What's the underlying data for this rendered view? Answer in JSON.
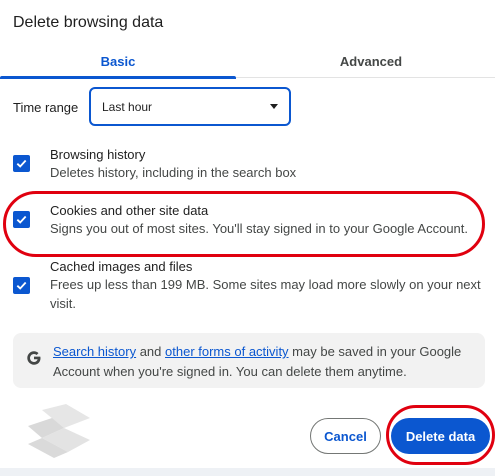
{
  "dialog": {
    "title": "Delete browsing data",
    "tabs": [
      {
        "label": "Basic",
        "selected": true
      },
      {
        "label": "Advanced",
        "selected": false
      }
    ],
    "time_range": {
      "label": "Time range",
      "selected": "Last hour"
    },
    "options": [
      {
        "title": "Browsing history",
        "description": "Deletes history, including in the search box",
        "checked": true
      },
      {
        "title": "Cookies and other site data",
        "description": "Signs you out of most sites. You'll stay signed in to your Google Account.",
        "checked": true
      },
      {
        "title": "Cached images and files",
        "description": "Frees up less than 199 MB. Some sites may load more slowly on your next visit.",
        "checked": true
      }
    ],
    "notice": {
      "link1": "Search history",
      "text1": " and ",
      "link2": "other forms of activity",
      "text2": " may be saved in your Google Account when you're signed in. You can delete them anytime."
    },
    "buttons": {
      "cancel": "Cancel",
      "delete": "Delete data"
    }
  },
  "colors": {
    "accent": "#0b57d0",
    "highlight": "#e0000f"
  }
}
